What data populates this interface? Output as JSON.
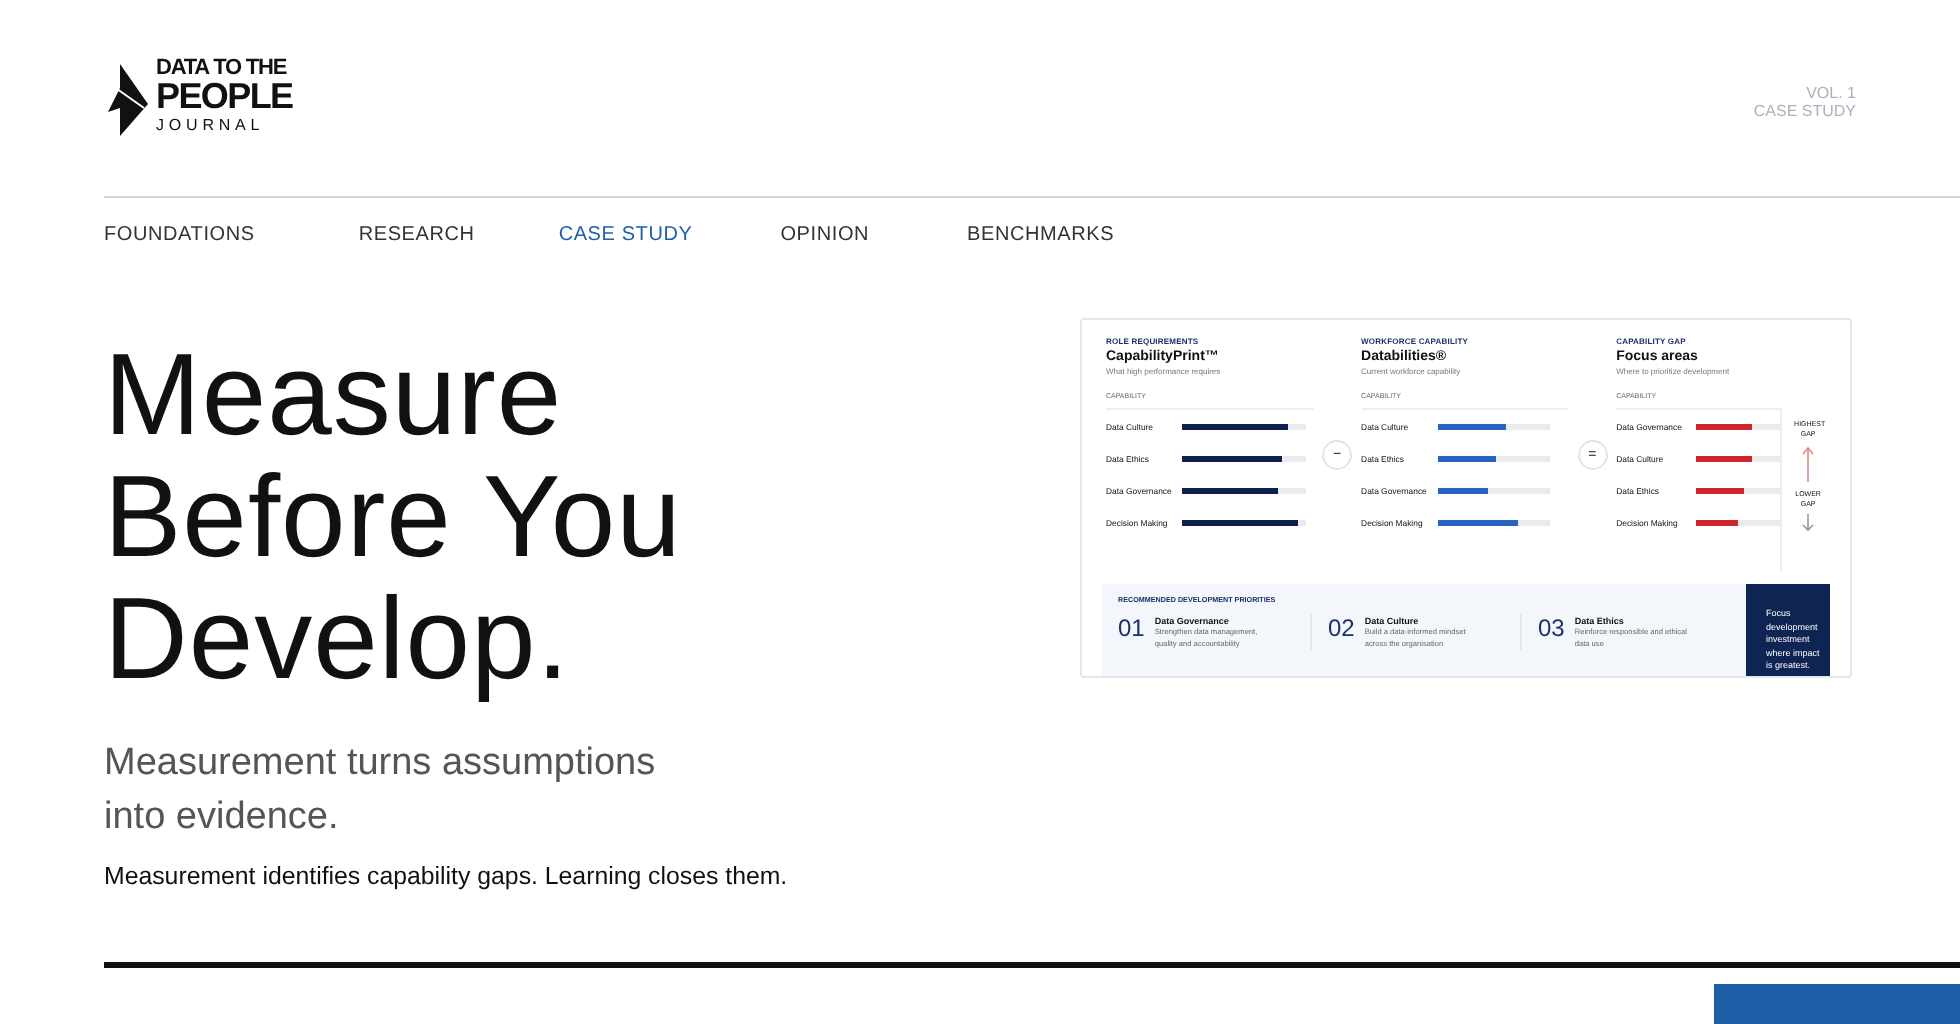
{
  "logo": {
    "lines": [
      "DATA TO THE",
      "PEOPLE",
      "JOURNAL"
    ]
  },
  "issue": {
    "volume": "VOL. 1",
    "section": "CASE STUDY"
  },
  "nav": [
    {
      "label": "FOUNDATIONS",
      "selected": false
    },
    {
      "label": "RESEARCH",
      "selected": false
    },
    {
      "label": "CASE STUDY",
      "selected": true
    },
    {
      "label": "OPINION",
      "selected": false
    },
    {
      "label": "BENCHMARKS",
      "selected": false
    }
  ],
  "hero": {
    "title": "Measure Before You Develop.",
    "subtitle": "Measurement turns assumptions into evidence.",
    "tagline": "Measurement identifies capability gaps. Learning closes them."
  },
  "figure": {
    "columns": [
      {
        "kind": "role",
        "eyebrow": "ROLE REQUIREMENTS",
        "title": "CapabilityPrint™",
        "subtitle": "What high performance requires",
        "axis_label": "CAPABILITY",
        "rows": [
          {
            "label": "Data Culture",
            "level": 0.85
          },
          {
            "label": "Data Ethics",
            "level": 0.81
          },
          {
            "label": "Data Governance",
            "level": 0.77
          },
          {
            "label": "Decision Making",
            "level": 0.94
          }
        ]
      },
      {
        "kind": "workforce",
        "eyebrow": "WORKFORCE CAPABILITY",
        "title": "Databilities®",
        "subtitle": "Current workforce capability",
        "axis_label": "CAPABILITY",
        "rows": [
          {
            "label": "Data Culture",
            "level": 0.62
          },
          {
            "label": "Data Ethics",
            "level": 0.52
          },
          {
            "label": "Data Governance",
            "level": 0.45
          },
          {
            "label": "Decision Making",
            "level": 0.72
          }
        ]
      },
      {
        "kind": "gap",
        "eyebrow": "CAPABILITY GAP",
        "title": "Focus areas",
        "subtitle": "Where to prioritize development",
        "axis_label": "CAPABILITY",
        "rows": [
          {
            "label": "Data Governance",
            "level": 0.67
          },
          {
            "label": "Data Culture",
            "level": 0.67
          },
          {
            "label": "Data Ethics",
            "level": 0.57
          },
          {
            "label": "Decision Making",
            "level": 0.5
          }
        ]
      }
    ],
    "operators": [
      "−",
      "="
    ],
    "legend": {
      "top": "HIGHEST GAP",
      "bottom": "LOWER GAP"
    },
    "priorities": {
      "heading": "RECOMMENDED DEVELOPMENT PRIORITIES",
      "items": [
        {
          "number": "01",
          "title": "Data Governance",
          "text": "Strengthen data management, quality and accountability"
        },
        {
          "number": "02",
          "title": "Data Culture",
          "text": "Build a data-informed mindset across the organisation"
        },
        {
          "number": "03",
          "title": "Data Ethics",
          "text": "Reinforce responsible and ethical data use"
        }
      ],
      "callout": "Focus development investment where impact is greatest."
    }
  }
}
